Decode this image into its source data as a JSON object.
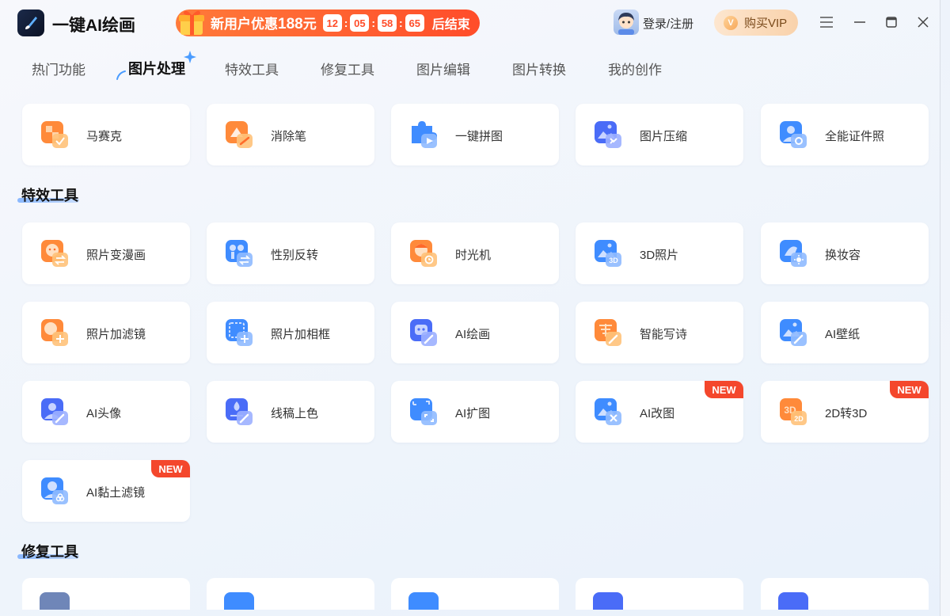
{
  "app": {
    "title": "一键AI绘画"
  },
  "promo": {
    "text": "新用户优惠",
    "amount": "188",
    "unit": "元",
    "countdown": [
      "12",
      "05",
      "58",
      "65"
    ],
    "suffix": "后结束"
  },
  "account": {
    "login_label": "登录/注册",
    "vip_label": "购买VIP",
    "vip_badge": "V"
  },
  "tabs": [
    {
      "label": "热门功能"
    },
    {
      "label": "图片处理",
      "active": true
    },
    {
      "label": "特效工具"
    },
    {
      "label": "修复工具"
    },
    {
      "label": "图片编辑"
    },
    {
      "label": "图片转换"
    },
    {
      "label": "我的创作"
    }
  ],
  "image_processing": {
    "items": [
      {
        "label": "马赛克"
      },
      {
        "label": "消除笔"
      },
      {
        "label": "一键拼图"
      },
      {
        "label": "图片压缩"
      },
      {
        "label": "全能证件照"
      }
    ]
  },
  "effects": {
    "title": "特效工具",
    "items": [
      {
        "label": "照片变漫画"
      },
      {
        "label": "性别反转"
      },
      {
        "label": "时光机"
      },
      {
        "label": "3D照片"
      },
      {
        "label": "换妆容"
      },
      {
        "label": "照片加滤镜"
      },
      {
        "label": "照片加相框"
      },
      {
        "label": "AI绘画"
      },
      {
        "label": "智能写诗"
      },
      {
        "label": "AI壁纸"
      },
      {
        "label": "AI头像"
      },
      {
        "label": "线稿上色"
      },
      {
        "label": "AI扩图"
      },
      {
        "label": "AI改图",
        "badge": "NEW"
      },
      {
        "label": "2D转3D",
        "badge": "NEW"
      },
      {
        "label": "AI黏土滤镜",
        "badge": "NEW"
      }
    ]
  },
  "repair": {
    "title": "修复工具"
  },
  "colors": {
    "orange": "#ff8a3a",
    "blue": "#3f8cff",
    "badge": "#f4472c",
    "promo": "#ff4d2a"
  }
}
